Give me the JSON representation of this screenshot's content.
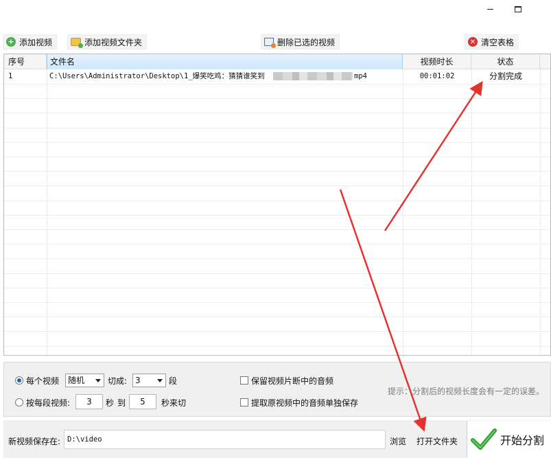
{
  "window": {
    "minimize_icon": "minimize-icon",
    "maximize_icon": "maximize-icon"
  },
  "toolbar": {
    "add_video": "添加视频",
    "add_folder": "添加视频文件夹",
    "delete_selected": "删除已选的视频",
    "clear_table": "清空表格"
  },
  "table": {
    "headers": [
      "序号",
      "文件名",
      "视频时长",
      "状态"
    ],
    "rows": [
      {
        "index": "1",
        "filename_prefix": "C:\\Users\\Administrator\\Desktop\\1_爆笑吃鸡：猜猜谁笑到",
        "filename_suffix": "mp4",
        "duration": "00:01:02",
        "status": "分割完成"
      }
    ]
  },
  "options": {
    "mode1_label": "每个视频",
    "mode1_select": "随机",
    "cut_label": "切成:",
    "cut_select": "3",
    "segment_unit": "段",
    "mode2_label": "按每段视频:",
    "from_value": "3",
    "seconds_unit": "秒",
    "to_label": "到",
    "to_value": "5",
    "cut_unit": "秒来切",
    "keep_audio_label": "保留视频片断中的音频",
    "extract_audio_label": "提取原视频中的音频单独保存",
    "hint": "提示：分割后的视频长度会有一定的误差。"
  },
  "save": {
    "label": "新视频保存在:",
    "path": "D:\\video",
    "browse": "浏览",
    "open_folder": "打开文件夹",
    "start": "开始分割"
  },
  "colors": {
    "arrow": "#e5322d",
    "accent": "#1f5fb8",
    "start_check": "#2e9b2e"
  }
}
